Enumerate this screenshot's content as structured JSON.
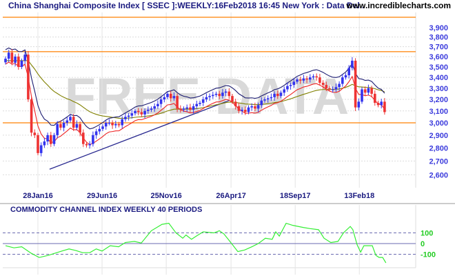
{
  "header": {
    "title": "China Shanghai Composite Index [ SSEC ]:WEEKLY:16Feb2018 16:45 New York : Data Del..",
    "site": "www.incrediblecharts.com"
  },
  "watermark": "FREE DATA",
  "colors": {
    "up": "#3333ee",
    "down": "#ee3333",
    "ma_fast": "#1a1a70",
    "ma_red": "#ee2222",
    "ma_slow": "#808000",
    "trendline": "#2a2a90",
    "levels": "#ff8000",
    "cci": "#33ee33"
  },
  "chart_data": [
    {
      "type": "candlestick",
      "title": "China Shanghai Composite Index [ SSEC ] Weekly",
      "yscale": "log",
      "ylim": [
        2550,
        4000
      ],
      "yticks": [
        2600,
        2700,
        2800,
        2900,
        3000,
        3100,
        3200,
        3300,
        3400,
        3500,
        3600,
        3700,
        3800,
        3900
      ],
      "ytick_labels": [
        "2,600",
        "2,700",
        "2,800",
        "2,900",
        "3,000",
        "3,100",
        "3,200",
        "3,300",
        "3,400",
        "3,500",
        "3,600",
        "3,700",
        "3,800",
        "3,900"
      ],
      "xticks": [
        {
          "week": 10,
          "label": "28Jan16"
        },
        {
          "week": 29.8,
          "label": "29Jun16"
        },
        {
          "week": 49.6,
          "label": "25Nov16"
        },
        {
          "week": 69.6,
          "label": "26Apr17"
        },
        {
          "week": 89.4,
          "label": "18Sep17"
        },
        {
          "week": 109.2,
          "label": "13Feb18"
        }
      ],
      "horizontal_levels": [
        3650,
        3000,
        3980
      ],
      "trendline": [
        [
          13.6,
          2640
        ],
        [
          69,
          3190
        ]
      ],
      "closes": [
        3580,
        3640,
        3540,
        3600,
        3500,
        3560,
        3620,
        3200,
        2920,
        2900,
        2760,
        2820,
        2850,
        2900,
        2830,
        2900,
        2990,
        2960,
        3000,
        3020,
        3050,
        2960,
        2990,
        2920,
        2830,
        2820,
        2830,
        2900,
        2930,
        2950,
        2970,
        3000,
        3000,
        2980,
        2990,
        2980,
        3030,
        3050,
        3060,
        3080,
        3100,
        3090,
        3070,
        3100,
        3110,
        3120,
        3140,
        3160,
        3200,
        3220,
        3250,
        3210,
        3230,
        3120,
        3110,
        3120,
        3130,
        3110,
        3140,
        3160,
        3170,
        3200,
        3220,
        3230,
        3240,
        3250,
        3230,
        3260,
        3270,
        3230,
        3180,
        3140,
        3100,
        3110,
        3090,
        3130,
        3140,
        3120,
        3150,
        3190,
        3200,
        3210,
        3220,
        3250,
        3230,
        3260,
        3290,
        3320,
        3330,
        3360,
        3380,
        3370,
        3390,
        3380,
        3400,
        3410,
        3400,
        3350,
        3330,
        3300,
        3290,
        3290,
        3310,
        3340,
        3400,
        3420,
        3490,
        3560,
        3130,
        3180,
        3290,
        3260,
        3300,
        3250,
        3170,
        3150,
        3180,
        3090
      ]
    },
    {
      "type": "line",
      "title": "COMMODITY CHANNEL INDEX WEEKLY 40 PERIODS",
      "ylim": [
        -220,
        260
      ],
      "yticks": [
        100,
        0,
        -100
      ],
      "ytick_labels": [
        "100",
        "0",
        "-100"
      ],
      "series": [
        {
          "name": "CCI 40",
          "points": [
            [
              0,
              -20
            ],
            [
              2.6,
              -40
            ],
            [
              5,
              -30
            ],
            [
              7.9,
              -90
            ],
            [
              10.4,
              -130
            ],
            [
              13.2,
              -110
            ],
            [
              17.4,
              -70
            ],
            [
              19.6,
              -50
            ],
            [
              21.7,
              -65
            ],
            [
              23.8,
              -85
            ],
            [
              26,
              -85
            ],
            [
              28,
              -50
            ],
            [
              29.8,
              -70
            ],
            [
              32.3,
              -20
            ],
            [
              34.9,
              -30
            ],
            [
              37,
              10
            ],
            [
              39.8,
              20
            ],
            [
              41.9,
              5
            ],
            [
              45,
              120
            ],
            [
              48.3,
              180
            ],
            [
              50.4,
              190
            ],
            [
              52.6,
              100
            ],
            [
              54.7,
              50
            ],
            [
              55.7,
              80
            ],
            [
              57.4,
              40
            ],
            [
              58.9,
              70
            ],
            [
              61,
              110
            ],
            [
              64.3,
              100
            ],
            [
              66,
              120
            ],
            [
              67.4,
              90
            ],
            [
              69,
              30
            ],
            [
              71.7,
              -75
            ],
            [
              73.8,
              -60
            ],
            [
              76,
              -30
            ],
            [
              78,
              0
            ],
            [
              80.2,
              50
            ],
            [
              82.3,
              40
            ],
            [
              83.4,
              110
            ],
            [
              84.5,
              70
            ],
            [
              86.6,
              190
            ],
            [
              88.7,
              170
            ],
            [
              92,
              150
            ],
            [
              94,
              140
            ],
            [
              96.6,
              130
            ],
            [
              98.3,
              50
            ],
            [
              100.4,
              10
            ],
            [
              102.6,
              20
            ],
            [
              104.3,
              100
            ],
            [
              106.4,
              160
            ],
            [
              107.2,
              130
            ],
            [
              108.5,
              -10
            ],
            [
              109.6,
              -80
            ],
            [
              110.6,
              -20
            ],
            [
              113.2,
              -20
            ],
            [
              114.3,
              -110
            ],
            [
              115.3,
              -130
            ],
            [
              116.4,
              -130
            ],
            [
              117.4,
              -180
            ]
          ]
        }
      ]
    }
  ]
}
